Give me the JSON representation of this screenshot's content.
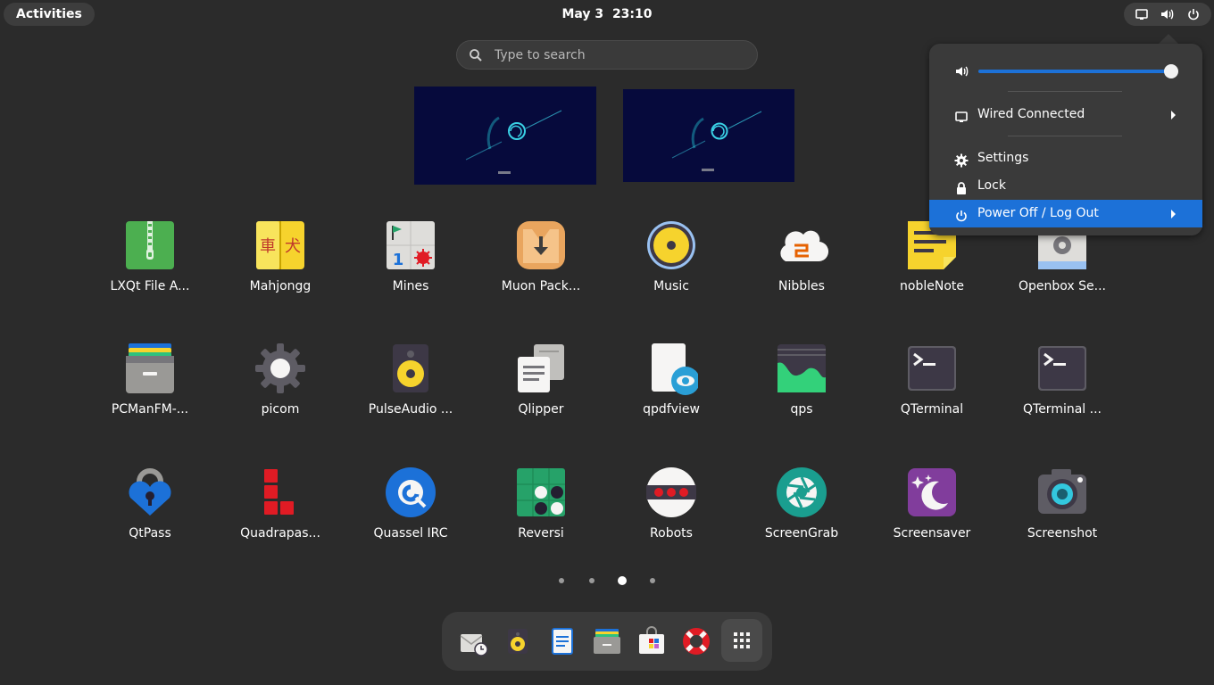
{
  "topbar": {
    "activities_label": "Activities",
    "date": "May 3",
    "time": "23:10"
  },
  "search": {
    "placeholder": "Type to search"
  },
  "apps": [
    {
      "label": "LXQt File A...",
      "icon": "archive-zip-icon"
    },
    {
      "label": "Mahjongg",
      "icon": "mahjongg-icon"
    },
    {
      "label": "Mines",
      "icon": "mines-icon"
    },
    {
      "label": "Muon Pack...",
      "icon": "muon-package-icon"
    },
    {
      "label": "Music",
      "icon": "music-icon"
    },
    {
      "label": "Nibbles",
      "icon": "nibbles-icon"
    },
    {
      "label": "nobleNote",
      "icon": "noblenote-icon"
    },
    {
      "label": "Openbox Se...",
      "icon": "openbox-settings-icon"
    },
    {
      "label": "PCManFM-...",
      "icon": "file-manager-icon"
    },
    {
      "label": "picom",
      "icon": "gear-icon"
    },
    {
      "label": "PulseAudio ...",
      "icon": "speaker-icon"
    },
    {
      "label": "Qlipper",
      "icon": "clipboard-icon"
    },
    {
      "label": "qpdfview",
      "icon": "document-viewer-icon"
    },
    {
      "label": "qps",
      "icon": "system-monitor-icon"
    },
    {
      "label": "QTerminal",
      "icon": "terminal-icon"
    },
    {
      "label": "QTerminal ...",
      "icon": "terminal-icon"
    },
    {
      "label": "QtPass",
      "icon": "password-lock-icon"
    },
    {
      "label": "Quadrapas...",
      "icon": "quadrapassel-icon"
    },
    {
      "label": "Quassel IRC",
      "icon": "quassel-irc-icon"
    },
    {
      "label": "Reversi",
      "icon": "reversi-icon"
    },
    {
      "label": "Robots",
      "icon": "robots-icon"
    },
    {
      "label": "ScreenGrab",
      "icon": "aperture-icon"
    },
    {
      "label": "Screensaver",
      "icon": "screensaver-moon-icon"
    },
    {
      "label": "Screenshot",
      "icon": "camera-icon"
    }
  ],
  "pages": {
    "count": 4,
    "active": 3
  },
  "dock": [
    {
      "icon": "mail-clock-icon"
    },
    {
      "icon": "speaker-icon"
    },
    {
      "icon": "text-document-icon"
    },
    {
      "icon": "file-manager-icon"
    },
    {
      "icon": "software-store-icon"
    },
    {
      "icon": "help-lifebuoy-icon"
    },
    {
      "icon": "app-grid-icon"
    }
  ],
  "system_menu": {
    "volume_level": 1.0,
    "network_label": "Wired Connected",
    "settings_label": "Settings",
    "lock_label": "Lock",
    "power_label": "Power Off / Log Out"
  },
  "colors": {
    "accent": "#1c71d8",
    "background": "#2b2b2b",
    "panel": "#3a3a3a"
  }
}
